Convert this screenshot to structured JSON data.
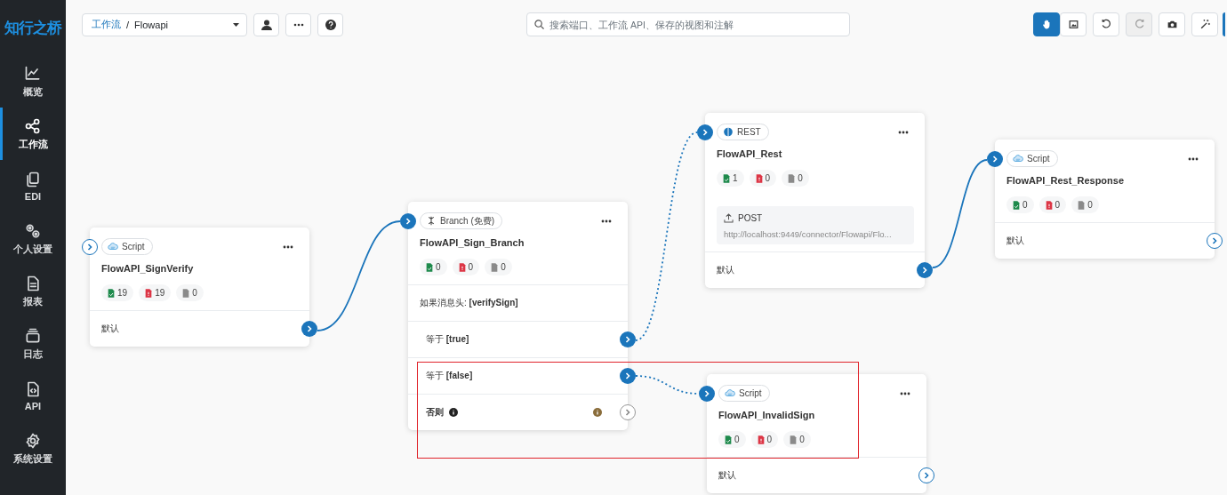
{
  "sidebar": {
    "logo": "知行之桥",
    "items": [
      {
        "label": "概览",
        "selected": false
      },
      {
        "label": "工作流",
        "selected": true
      },
      {
        "label": "EDI",
        "selected": false
      },
      {
        "label": "个人设置",
        "selected": false
      },
      {
        "label": "报表",
        "selected": false
      },
      {
        "label": "日志",
        "selected": false
      },
      {
        "label": "API",
        "selected": false
      },
      {
        "label": "系统设置",
        "selected": false
      }
    ]
  },
  "toolbar": {
    "breadcrumb": {
      "parent": "工作流",
      "separator": "/",
      "current": "Flowapi"
    },
    "search": {
      "placeholder": "搜索端口、工作流 API、保存的视图和注解"
    },
    "tools": [
      {
        "selected": true,
        "disabled": false
      },
      {
        "selected": false,
        "disabled": false
      },
      {
        "selected": false,
        "disabled": false
      },
      {
        "selected": false,
        "disabled": true
      },
      {
        "selected": false,
        "disabled": false
      },
      {
        "selected": false,
        "disabled": false
      }
    ]
  },
  "canvas": {
    "nodes": [
      {
        "type": {
          "kind": "script",
          "label": "Script"
        },
        "title": "FlowAPI_SignVerify",
        "input_connected": false,
        "stats": [
          {
            "kind": "success",
            "count": "19"
          },
          {
            "kind": "error",
            "count": "19"
          },
          {
            "kind": "pending",
            "count": "0"
          }
        ],
        "rows": [
          {
            "kind": "output",
            "text": "默认",
            "connected": true
          }
        ]
      },
      {
        "type": {
          "kind": "branch",
          "label": "Branch (免费)"
        },
        "title": "FlowAPI_Sign_Branch",
        "input_connected": true,
        "stats": [
          {
            "kind": "success",
            "count": "0"
          },
          {
            "kind": "error",
            "count": "0"
          },
          {
            "kind": "pending",
            "count": "0"
          }
        ],
        "rows": [
          {
            "kind": "condition",
            "text": "如果消息头: **[verifySign]**"
          },
          {
            "kind": "case",
            "text": "等于 **[true]**",
            "connected": true
          },
          {
            "kind": "case",
            "text": "等于 **[false]**",
            "connected": true
          },
          {
            "kind": "otherwise",
            "text": "否则",
            "connected": false
          }
        ]
      },
      {
        "type": {
          "kind": "rest",
          "label": "REST"
        },
        "title": "FlowAPI_Rest",
        "input_connected": true,
        "stats": [
          {
            "kind": "success",
            "count": "1"
          },
          {
            "kind": "error",
            "count": "0"
          },
          {
            "kind": "pending",
            "count": "0"
          }
        ],
        "request": {
          "method": "POST",
          "url": "http://localhost:9449/connector/Flowapi/Flo..."
        },
        "rows": [
          {
            "kind": "output",
            "text": "默认",
            "connected": true
          }
        ]
      },
      {
        "type": {
          "kind": "script",
          "label": "Script"
        },
        "title": "FlowAPI_Rest_Response",
        "input_connected": true,
        "stats": [
          {
            "kind": "success",
            "count": "0"
          },
          {
            "kind": "error",
            "count": "0"
          },
          {
            "kind": "pending",
            "count": "0"
          }
        ],
        "rows": [
          {
            "kind": "output",
            "text": "默认",
            "connected": false
          }
        ]
      },
      {
        "type": {
          "kind": "script",
          "label": "Script"
        },
        "title": "FlowAPI_InvalidSign",
        "input_connected": true,
        "stats": [
          {
            "kind": "success",
            "count": "0"
          },
          {
            "kind": "error",
            "count": "0"
          },
          {
            "kind": "pending",
            "count": "0"
          }
        ],
        "rows": [
          {
            "kind": "output",
            "text": "默认",
            "connected": false
          }
        ]
      }
    ],
    "links": [
      {
        "kind": "solid"
      },
      {
        "kind": "dotted"
      },
      {
        "kind": "dotted"
      },
      {
        "kind": "solid"
      }
    ]
  }
}
